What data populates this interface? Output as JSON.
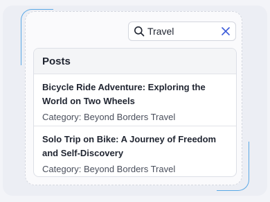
{
  "search": {
    "value": "Travel",
    "icon": "search-icon",
    "clear_icon": "close-icon"
  },
  "results": {
    "header": "Posts",
    "items": [
      {
        "title": "Bicycle Ride Adventure: Exploring the World on Two Wheels",
        "category": "Category: Beyond Borders Travel"
      },
      {
        "title": "Solo Trip on Bike: A Journey of Freedom and Self-Discovery",
        "category": "Category: Beyond Borders Travel"
      }
    ]
  },
  "colors": {
    "accent": "#59a8e6",
    "clear_icon": "#3b5bd9",
    "text": "#1f2430"
  }
}
